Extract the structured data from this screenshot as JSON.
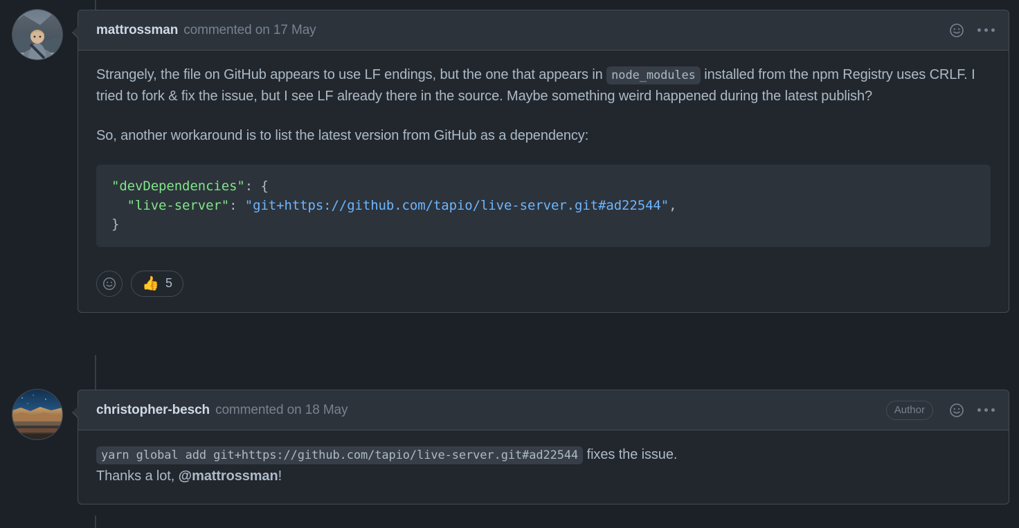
{
  "theme": {
    "page_bg": "#1c2128",
    "comment_bg": "#22272e",
    "header_bg": "#2d333b",
    "border": "#444c56",
    "text": "#adbac7",
    "muted": "#768390",
    "code_string": "#7ee787",
    "code_value": "#6cb6ff",
    "rail": "#373e47"
  },
  "comments": [
    {
      "author": "mattrossman",
      "meta": "commented on 17 May",
      "is_author_badge": false,
      "author_badge_label": "",
      "add_reaction_icon": "smiley-icon",
      "menu_icon": "kebab-menu-icon",
      "body": {
        "para1_a": "Strangely, the file on GitHub appears to use LF endings, but the one that appears in ",
        "para1_code": "node_modules",
        "para1_b": " installed from the npm Registry uses CRLF. I tried to fork & fix the issue, but I see LF already there in the source. Maybe something weird happened during the latest publish?",
        "para2": "So, another workaround is to list the latest version from GitHub as a dependency:",
        "code_lines": [
          {
            "key": "\"devDependencies\"",
            "sep": ": {",
            "value": "",
            "tail": ""
          },
          {
            "key": "  \"live-server\"",
            "sep": ": ",
            "value": "\"git+https://github.com/tapio/live-server.git#ad22544\"",
            "tail": ","
          },
          {
            "key": "",
            "sep": "}",
            "value": "",
            "tail": ""
          }
        ]
      },
      "reactions": [
        {
          "emoji": "👍",
          "count": "5",
          "name": "thumbs-up"
        }
      ]
    },
    {
      "author": "christopher-besch",
      "meta": "commented on 18 May",
      "is_author_badge": true,
      "author_badge_label": "Author",
      "add_reaction_icon": "smiley-icon",
      "menu_icon": "kebab-menu-icon",
      "body": {
        "line1_code": "yarn global add git+https://github.com/tapio/live-server.git#ad22544",
        "line1_after": " fixes the issue.",
        "line2_a": "Thanks a lot, ",
        "line2_mention": "@mattrossman",
        "line2_b": "!"
      },
      "reactions": []
    }
  ]
}
